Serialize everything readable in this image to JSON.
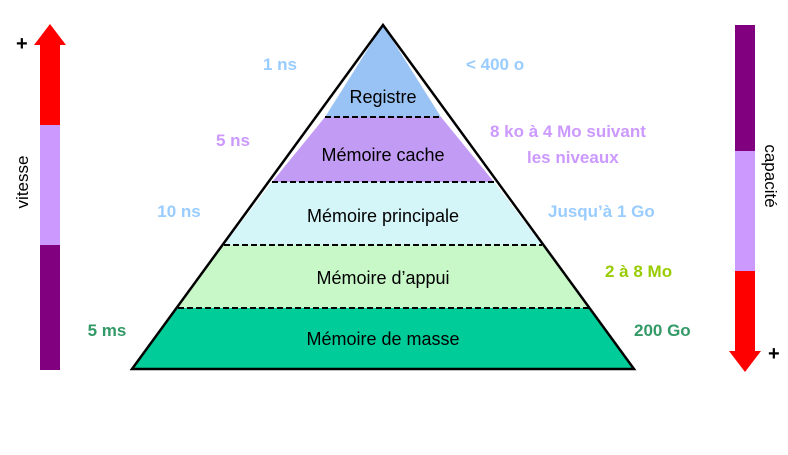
{
  "colors": {
    "registre": "#99c3f5",
    "cache": "#c29cf4",
    "principale": "#d4f6f8",
    "appui": "#c8f8c8",
    "masse": "#00cc99",
    "arrow_red": "#ff0000",
    "arrow_lavender": "#cc99ff",
    "arrow_purple": "#800080",
    "text_blue": "#99ccff",
    "text_lavender": "#cc99ff",
    "text_green": "#339966",
    "text_lime": "#99cc00"
  },
  "levels": [
    {
      "id": "registre",
      "name": "Registre",
      "speed": "1 ns",
      "capacity": "< 400 o"
    },
    {
      "id": "cache",
      "name": "Mémoire cache",
      "speed": "5 ns",
      "capacity_line1": "8 ko à 4 Mo suivant",
      "capacity_line2": "les niveaux"
    },
    {
      "id": "principale",
      "name": "Mémoire principale",
      "speed": "10 ns",
      "capacity": "Jusqu’à 1 Go"
    },
    {
      "id": "appui",
      "name": "Mémoire d’appui",
      "capacity": "2 à 8 Mo"
    },
    {
      "id": "masse",
      "name": "Mémoire de masse",
      "speed": "5 ms",
      "capacity": "200 Go"
    }
  ],
  "left_axis": {
    "label": "vitesse",
    "plus": "+"
  },
  "right_axis": {
    "label": "capacité",
    "plus": "+"
  }
}
